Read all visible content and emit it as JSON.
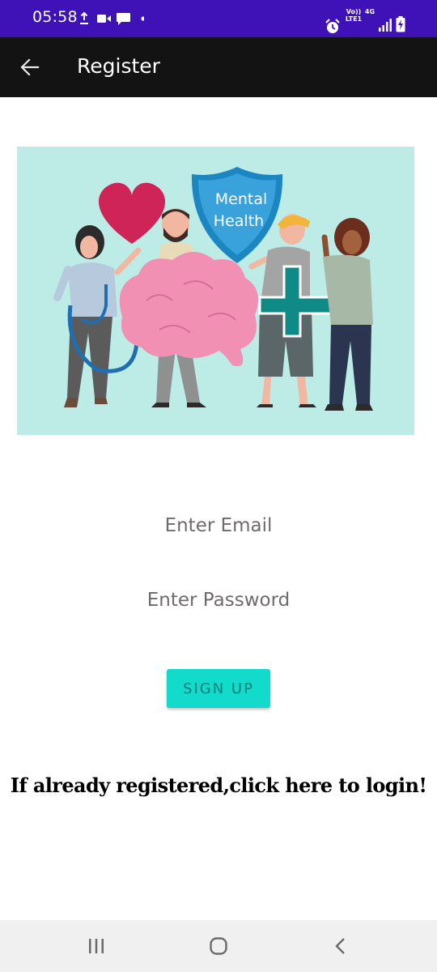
{
  "status_bar": {
    "time": "05:58",
    "net_label": "Vo)) LTE1",
    "net_top": "Vo))",
    "net_bottom": "LTE1",
    "fourg": "4G",
    "icons": [
      "upload-icon",
      "video-icon",
      "message-icon",
      "dot-icon",
      "alarm-icon",
      "signal-icon",
      "battery-charging-icon"
    ],
    "background": "#3f12b8"
  },
  "app_bar": {
    "title": "Register",
    "back_icon": "arrow-left-icon",
    "background": "#131313"
  },
  "hero": {
    "shield_line1": "Mental",
    "shield_line2": "Health",
    "background": "#bdebe6"
  },
  "form": {
    "email_placeholder": "Enter Email",
    "email_value": "",
    "password_placeholder": "Enter Password",
    "password_value": "",
    "signup_label": "SIGN UP",
    "signup_color": "#12dbcb"
  },
  "login_link": {
    "text": "If already registered,click here to login!"
  },
  "nav_bar": {
    "recents_icon": "recents-icon",
    "home_icon": "home-icon",
    "back_icon": "back-icon"
  }
}
